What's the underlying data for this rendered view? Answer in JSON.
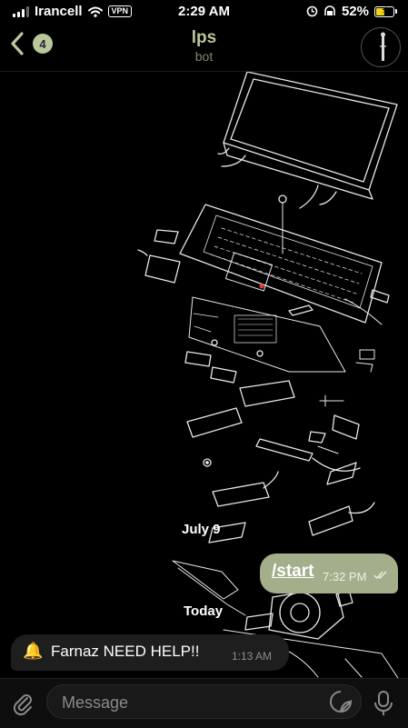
{
  "status_bar": {
    "carrier": "Irancell",
    "vpn": "VPN",
    "time": "2:29 AM",
    "battery": "52%",
    "battery_level": 0.52
  },
  "header": {
    "back_badge": "4",
    "title": "lps",
    "subtitle": "bot"
  },
  "chat": {
    "date_separators": [
      "July 9",
      "Today"
    ],
    "messages": [
      {
        "direction": "outgoing",
        "text": "/start",
        "time": "7:32 PM"
      },
      {
        "direction": "incoming",
        "text": "Farnaz NEED HELP!!",
        "time": "1:13 AM"
      }
    ]
  },
  "composer": {
    "placeholder": "Message"
  },
  "icons": {
    "signal": "cellular-signal-icon",
    "wifi": "wifi-icon",
    "alarm": "alarm-icon",
    "network": "network-icon",
    "battery": "battery-icon",
    "back": "chevron-left-icon",
    "attach": "paperclip-icon",
    "sticker": "sticker-icon",
    "mic": "microphone-icon",
    "bell": "bell-icon",
    "read": "double-check-icon"
  },
  "colors": {
    "accent": "#b9c89a",
    "outgoing_bubble": "#a3ae8b",
    "incoming_bubble": "#1e1e1e",
    "battery_fill": "#f5d214"
  }
}
